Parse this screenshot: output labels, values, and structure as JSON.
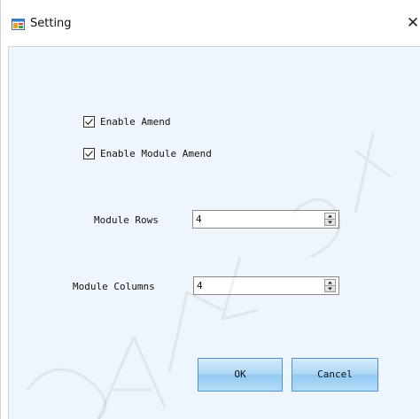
{
  "window": {
    "title": "Setting",
    "close_glyph": "✕"
  },
  "options": {
    "enable_amend": {
      "label": "Enable Amend",
      "checked": true
    },
    "enable_module_amend": {
      "label": "Enable Module Amend",
      "checked": true
    }
  },
  "fields": {
    "module_rows": {
      "label": "Module Rows",
      "value": "4"
    },
    "module_columns": {
      "label": "Module Columns",
      "value": "4"
    }
  },
  "buttons": {
    "ok": "OK",
    "cancel": "Cancel"
  },
  "icons": {
    "app": "window-app-icon",
    "check": "checkmark-icon",
    "spin_up": "arrow-up-icon",
    "spin_down": "arrow-down-icon"
  },
  "colors": {
    "client_background": "#eef5fc",
    "button_border": "#4a90d9"
  }
}
